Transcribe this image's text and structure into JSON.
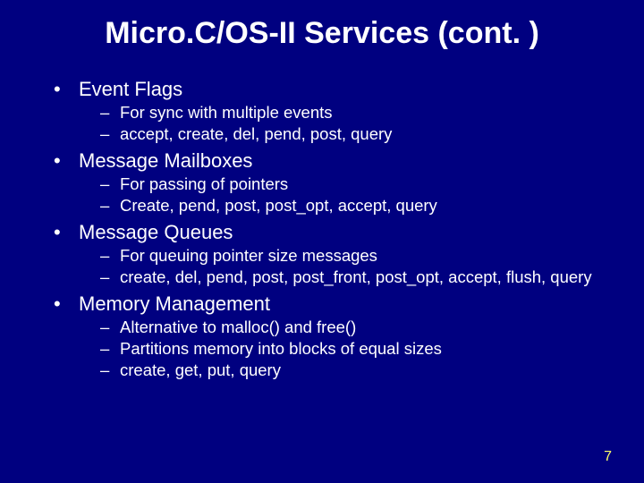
{
  "title": "Micro.C/OS-II Services (cont. )",
  "sections": [
    {
      "heading": "Event Flags",
      "subs": [
        "For sync with multiple events",
        "accept, create, del, pend, post, query"
      ]
    },
    {
      "heading": "Message Mailboxes",
      "subs": [
        " For passing of pointers",
        "Create, pend, post, post_opt, accept, query"
      ]
    },
    {
      "heading": "Message Queues",
      "subs": [
        "For queuing pointer size messages",
        "create, del, pend, post, post_front, post_opt, accept, flush, query"
      ]
    },
    {
      "heading": "Memory Management",
      "subs": [
        "Alternative to malloc() and free()",
        "Partitions memory into blocks of equal sizes",
        "create, get, put, query"
      ]
    }
  ],
  "page_number": "7",
  "bullet_char": "•",
  "dash_char": "–"
}
